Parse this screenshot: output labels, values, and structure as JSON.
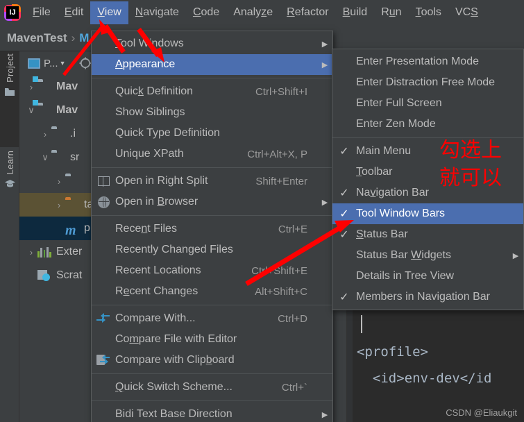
{
  "app": {
    "logo_text": "IJ",
    "watermark": "CSDN @Eliaukgit"
  },
  "menubar": {
    "items": [
      {
        "label": "File",
        "mnemonic": "F",
        "active": false
      },
      {
        "label": "Edit",
        "mnemonic": "E",
        "active": false
      },
      {
        "label": "View",
        "mnemonic": "V",
        "active": true
      },
      {
        "label": "Navigate",
        "mnemonic": "N",
        "active": false
      },
      {
        "label": "Code",
        "mnemonic": "C",
        "active": false
      },
      {
        "label": "Analyze",
        "mnemonic": "z",
        "active": false
      },
      {
        "label": "Refactor",
        "mnemonic": "R",
        "active": false
      },
      {
        "label": "Build",
        "mnemonic": "B",
        "active": false
      },
      {
        "label": "Run",
        "mnemonic": "u",
        "active": false
      },
      {
        "label": "Tools",
        "mnemonic": "T",
        "active": false
      },
      {
        "label": "VCS",
        "mnemonic": "S",
        "active": false
      }
    ]
  },
  "navbar": {
    "project": "MavenTest",
    "separator": "›",
    "next": "M"
  },
  "tool_stripe": {
    "buttons": [
      {
        "label": "Project",
        "icon": "folder-icon",
        "selected": true
      },
      {
        "label": "Learn",
        "icon": "graduation-cap-icon",
        "selected": false
      }
    ]
  },
  "project_panel": {
    "tab_label": "P...",
    "tab_icon": "project-view-icon",
    "settings_icon": "gear-icon",
    "tree": [
      {
        "label": "Mav",
        "arrow": "›",
        "icon": "module-folder-icon",
        "indent": 0,
        "highlight": "none"
      },
      {
        "label": "Mav",
        "arrow": "∨",
        "icon": "module-folder-icon",
        "indent": 0,
        "highlight": "none"
      },
      {
        "label": ".i",
        "arrow": "›",
        "icon": "folder-icon",
        "indent": 1,
        "highlight": "none"
      },
      {
        "label": "sr",
        "arrow": "∨",
        "icon": "folder-icon",
        "indent": 1,
        "highlight": "none"
      },
      {
        "label": "",
        "arrow": "›",
        "icon": "folder-icon",
        "indent": 2,
        "highlight": "none"
      },
      {
        "label": "ta",
        "arrow": "›",
        "icon": "target-folder-icon",
        "indent": 2,
        "highlight": "olive"
      },
      {
        "label": "p",
        "arrow": "",
        "icon": "maven-pom-icon",
        "indent": 2,
        "highlight": "blue"
      },
      {
        "label": "Exter",
        "arrow": "›",
        "icon": "libraries-icon",
        "indent": 0,
        "highlight": "none"
      },
      {
        "label": "Scrat",
        "arrow": "",
        "icon": "scratches-icon",
        "indent": 0,
        "highlight": "none"
      }
    ]
  },
  "view_menu": {
    "items": [
      {
        "label": "Tool Windows",
        "mnemonic": "T",
        "shortcut": "",
        "submenu": true,
        "icon": "",
        "checked": null,
        "highlight": false,
        "separator_after": false
      },
      {
        "label": "Appearance",
        "mnemonic": "A",
        "shortcut": "",
        "submenu": true,
        "icon": "",
        "checked": null,
        "highlight": true,
        "separator_after": true
      },
      {
        "label": "Quick Definition",
        "mnemonic": "k",
        "shortcut": "Ctrl+Shift+I",
        "submenu": false,
        "icon": "",
        "checked": null,
        "highlight": false,
        "separator_after": false
      },
      {
        "label": "Show Siblings",
        "mnemonic": "",
        "shortcut": "",
        "submenu": false,
        "icon": "",
        "checked": null,
        "highlight": false,
        "separator_after": false
      },
      {
        "label": "Quick Type Definition",
        "mnemonic": "",
        "shortcut": "",
        "submenu": false,
        "icon": "",
        "checked": null,
        "highlight": false,
        "separator_after": false
      },
      {
        "label": "Unique XPath",
        "mnemonic": "",
        "shortcut": "Ctrl+Alt+X, P",
        "submenu": false,
        "icon": "",
        "checked": null,
        "highlight": false,
        "separator_after": true
      },
      {
        "label": "Open in Right Split",
        "mnemonic": "",
        "shortcut": "Shift+Enter",
        "submenu": false,
        "icon": "split-icon",
        "checked": null,
        "highlight": false,
        "separator_after": false
      },
      {
        "label": "Open in Browser",
        "mnemonic": "B",
        "shortcut": "",
        "submenu": true,
        "icon": "globe-icon",
        "checked": null,
        "highlight": false,
        "separator_after": true
      },
      {
        "label": "Recent Files",
        "mnemonic": "n",
        "shortcut": "Ctrl+E",
        "submenu": false,
        "icon": "",
        "checked": null,
        "highlight": false,
        "separator_after": false
      },
      {
        "label": "Recently Changed Files",
        "mnemonic": "",
        "shortcut": "",
        "submenu": false,
        "icon": "",
        "checked": null,
        "highlight": false,
        "separator_after": false
      },
      {
        "label": "Recent Locations",
        "mnemonic": "",
        "shortcut": "Ctrl+Shift+E",
        "submenu": false,
        "icon": "",
        "checked": null,
        "highlight": false,
        "separator_after": false
      },
      {
        "label": "Recent Changes",
        "mnemonic": "e",
        "shortcut": "Alt+Shift+C",
        "submenu": false,
        "icon": "",
        "checked": null,
        "highlight": false,
        "separator_after": true
      },
      {
        "label": "Compare With...",
        "mnemonic": "",
        "shortcut": "Ctrl+D",
        "submenu": false,
        "icon": "compare-icon",
        "checked": null,
        "highlight": false,
        "separator_after": false
      },
      {
        "label": "Compare File with Editor",
        "mnemonic": "m",
        "shortcut": "",
        "submenu": false,
        "icon": "",
        "checked": null,
        "highlight": false,
        "separator_after": false
      },
      {
        "label": "Compare with Clipboard",
        "mnemonic": "b",
        "shortcut": "",
        "submenu": false,
        "icon": "clipboard-icon",
        "checked": null,
        "highlight": false,
        "separator_after": true
      },
      {
        "label": "Quick Switch Scheme...",
        "mnemonic": "Q",
        "shortcut": "Ctrl+`",
        "submenu": false,
        "icon": "",
        "checked": null,
        "highlight": false,
        "separator_after": true
      },
      {
        "label": "Bidi Text Base Direction",
        "mnemonic": "",
        "shortcut": "",
        "submenu": true,
        "icon": "",
        "checked": null,
        "highlight": false,
        "separator_after": false
      }
    ]
  },
  "appearance_menu": {
    "items": [
      {
        "label": "Enter Presentation Mode",
        "mnemonic": "",
        "submenu": false,
        "checked": false,
        "highlight": false,
        "separator_after": false
      },
      {
        "label": "Enter Distraction Free Mode",
        "mnemonic": "",
        "submenu": false,
        "checked": false,
        "highlight": false,
        "separator_after": false
      },
      {
        "label": "Enter Full Screen",
        "mnemonic": "",
        "submenu": false,
        "checked": false,
        "highlight": false,
        "separator_after": false
      },
      {
        "label": "Enter Zen Mode",
        "mnemonic": "",
        "submenu": false,
        "checked": false,
        "highlight": false,
        "separator_after": true
      },
      {
        "label": "Main Menu",
        "mnemonic": "",
        "submenu": false,
        "checked": true,
        "highlight": false,
        "separator_after": false
      },
      {
        "label": "Toolbar",
        "mnemonic": "T",
        "submenu": false,
        "checked": false,
        "highlight": false,
        "separator_after": false
      },
      {
        "label": "Navigation Bar",
        "mnemonic": "v",
        "submenu": false,
        "checked": true,
        "highlight": false,
        "separator_after": false
      },
      {
        "label": "Tool Window Bars",
        "mnemonic": "",
        "submenu": false,
        "checked": true,
        "highlight": true,
        "separator_after": false
      },
      {
        "label": "Status Bar",
        "mnemonic": "S",
        "submenu": false,
        "checked": true,
        "highlight": false,
        "separator_after": false
      },
      {
        "label": "Status Bar Widgets",
        "mnemonic": "W",
        "submenu": true,
        "checked": false,
        "highlight": false,
        "separator_after": false
      },
      {
        "label": "Details in Tree View",
        "mnemonic": "",
        "submenu": false,
        "checked": false,
        "highlight": false,
        "separator_after": false
      },
      {
        "label": "Members in Navigation Bar",
        "mnemonic": "",
        "submenu": false,
        "checked": true,
        "highlight": false,
        "separator_after": false
      }
    ]
  },
  "editor": {
    "lines": [
      "",
      "<profile>",
      "  <id>env-dev</id"
    ]
  },
  "annotations": {
    "chinese_note_line1": "勾选上",
    "chinese_note_line2": "就可以",
    "color": "#FF0000"
  },
  "colors": {
    "background": "#3C3F41",
    "menu_highlight": "#4B6EAF",
    "editor_background": "#2B2B2B",
    "text": "#BBBBBB",
    "accent_blue": "#3592C4",
    "annotation_red": "#FF0000"
  }
}
